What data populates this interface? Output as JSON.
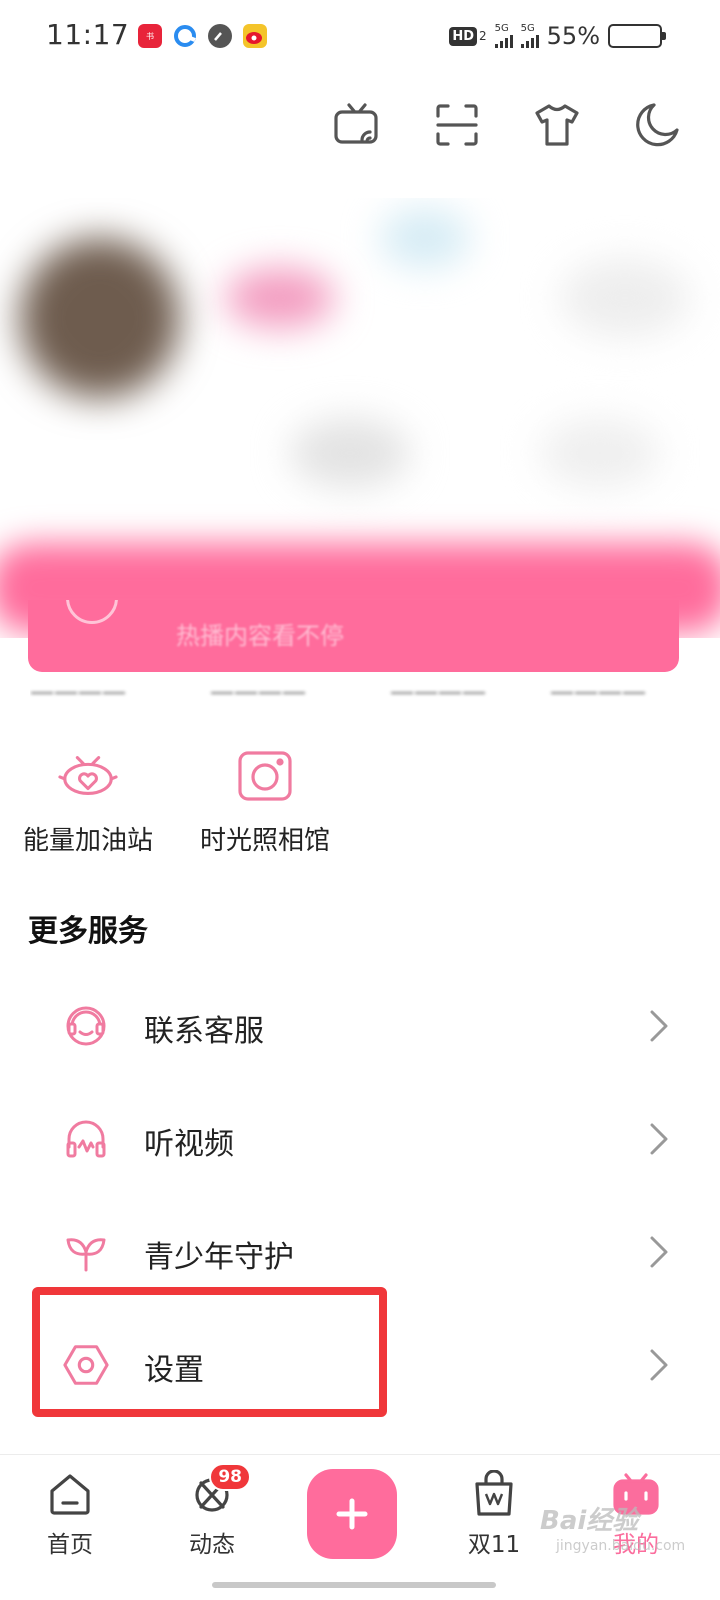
{
  "status_bar": {
    "time": "11:17",
    "app_icons": [
      "xiaohongshu-icon",
      "browser-icon",
      "speedometer-icon",
      "weibo-icon"
    ],
    "network_badge": "HD",
    "network_sub": "2",
    "signal_1": "5G",
    "signal_2": "5G",
    "battery_percent": "55%",
    "battery_level": 0.55
  },
  "header": {
    "icons": [
      "tv-cast-icon",
      "scan-icon",
      "tshirt-icon",
      "moon-icon"
    ]
  },
  "vip_banner": {
    "ghost_text": "热播内容看不停",
    "accent": "#ff6c9c"
  },
  "features": [
    {
      "label": "能量加油站",
      "icon": "energy-station-icon"
    },
    {
      "label": "时光照相馆",
      "icon": "camera-icon"
    }
  ],
  "more_services": {
    "title": "更多服务",
    "items": [
      {
        "label": "联系客服",
        "icon": "customer-service-icon"
      },
      {
        "label": "听视频",
        "icon": "headphones-icon"
      },
      {
        "label": "青少年守护",
        "icon": "sprout-icon"
      },
      {
        "label": "设置",
        "icon": "settings-icon"
      }
    ]
  },
  "bottom_nav": {
    "items": [
      {
        "label": "首页",
        "icon": "home-icon"
      },
      {
        "label": "动态",
        "icon": "activity-icon",
        "badge": "98"
      },
      {
        "label": "双11",
        "icon": "shopping-bag-icon"
      },
      {
        "label": "我的",
        "icon": "tv-mascot-icon",
        "active": true
      }
    ],
    "plus_label": "+"
  },
  "watermark": {
    "text": "Bai经验",
    "sub": "jingyan.baidu.com"
  },
  "colors": {
    "accent_pink": "#fb6d9d",
    "highlight_red": "#f0373a"
  }
}
